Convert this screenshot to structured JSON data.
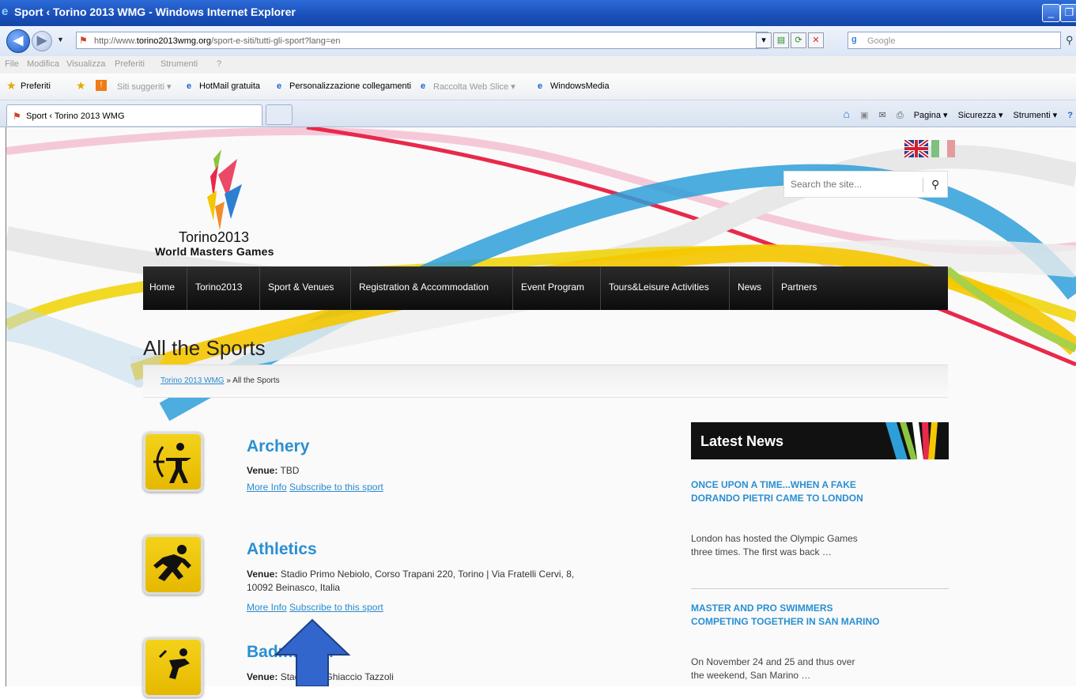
{
  "browser": {
    "window_title": "Sport ‹ Torino 2013 WMG - Windows Internet Explorer",
    "url_prefix": "http://www.",
    "url_domain": "torino2013wmg.org",
    "url_path": "/sport-e-siti/tutti-gli-sport?lang=en",
    "search_placeholder": "Google",
    "menu": [
      "File",
      "Modifica",
      "Visualizza",
      "Preferiti",
      "Strumenti",
      "?"
    ],
    "favorites_label": "Preferiti",
    "favorites": [
      "Siti suggeriti ▾",
      "HotMail gratuita",
      "Personalizzazione collegamenti",
      "Raccolta Web Slice ▾",
      "WindowsMedia"
    ],
    "tab_title": "Sport ‹ Torino 2013 WMG",
    "commands": [
      "Pagina ▾",
      "Sicurezza ▾",
      "Strumenti ▾"
    ]
  },
  "site": {
    "logo_line1": "Torino2013",
    "logo_line2": "World Masters Games",
    "search_placeholder": "Search the site...",
    "nav": [
      "Home",
      "Torino2013",
      "Sport & Venues",
      "Registration & Accommodation",
      "Event Program",
      "Tours&Leisure Activities",
      "News",
      "Partners"
    ],
    "page_title": "All the Sports",
    "breadcrumb_link": "Torino 2013 WMG",
    "breadcrumb_current": " » All the Sports",
    "venue_label": "Venue:",
    "more_info": "More Info",
    "subscribe": "Subscribe to this sport",
    "sports": [
      {
        "name": "Archery",
        "venue_line1": " TBD",
        "venue_line2": ""
      },
      {
        "name": "Athletics",
        "venue_line1": " Stadio Primo Nebiolo, Corso Trapani 220, Torino | Via Fratelli Cervi, 8,",
        "venue_line2": "10092 Beinasco, Italia"
      },
      {
        "name": "Badminton",
        "venue_line1": " Stadio del Ghiaccio Tazzoli",
        "venue_line2": ""
      }
    ],
    "news_header": "Latest News",
    "news": [
      {
        "title": "ONCE UPON A TIME...WHEN A FAKE DORANDO PIETRI CAME TO LONDON",
        "text": "London has hosted the Olympic Games three times. The first was back …"
      },
      {
        "title": "MASTER AND PRO SWIMMERS COMPETING TOGETHER IN SAN MARINO",
        "text": "On November 24 and 25 and thus over the weekend, San Marino …"
      }
    ]
  },
  "colors": {
    "accent_blue": "#2a8fd2",
    "icon_yellow": "#f4d21a",
    "nav_black": "#111111",
    "arrow_blue": "#3366cc"
  }
}
